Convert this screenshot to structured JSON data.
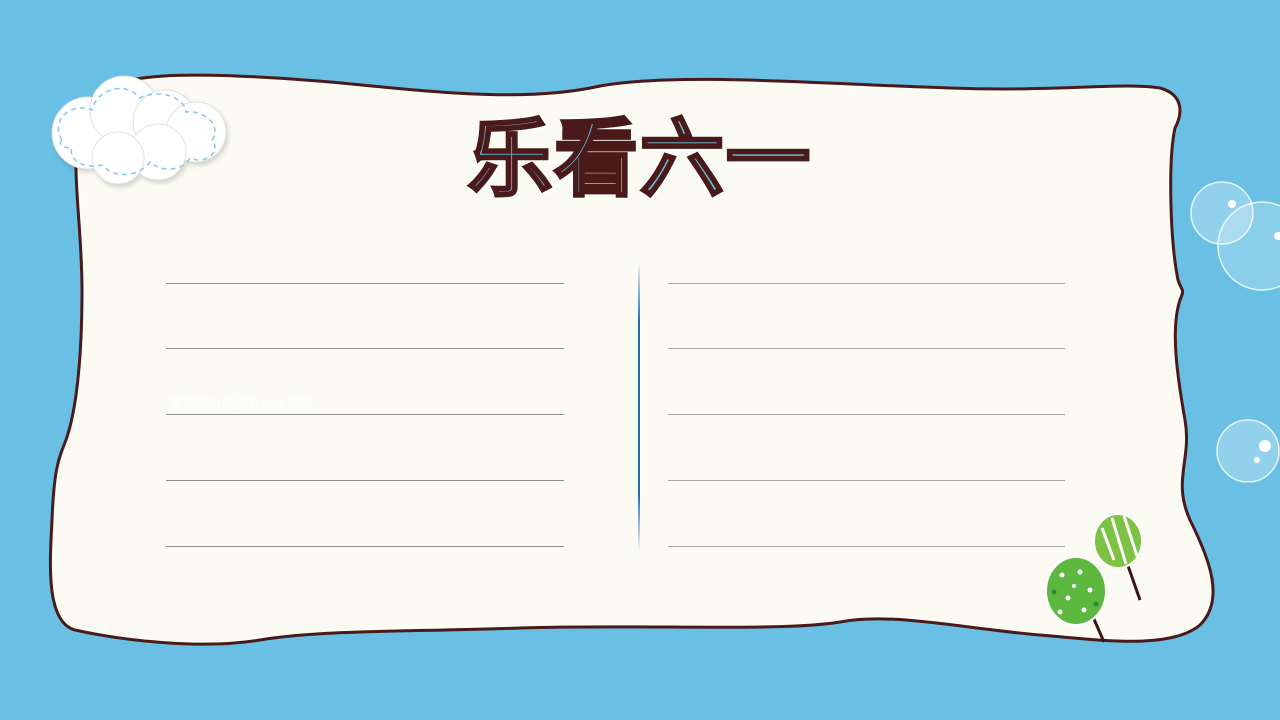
{
  "title": "乐看六一",
  "faint_text": "要想为方面图标点击添加：",
  "colors": {
    "background": "#69c0e4",
    "paper": "#fbfbf4",
    "outline": "#4a1a1a",
    "title_fill": "#6ec3e6",
    "cloud_dash": "#8ccbe8",
    "tree_green": "#5cb83e",
    "tree_light": "#8dcc52",
    "divider": "#1f6fb4"
  },
  "icons": {
    "cloud": "cloud-icon",
    "bubbles": "bubble-icon",
    "trees": "lollipop-tree-icon"
  }
}
